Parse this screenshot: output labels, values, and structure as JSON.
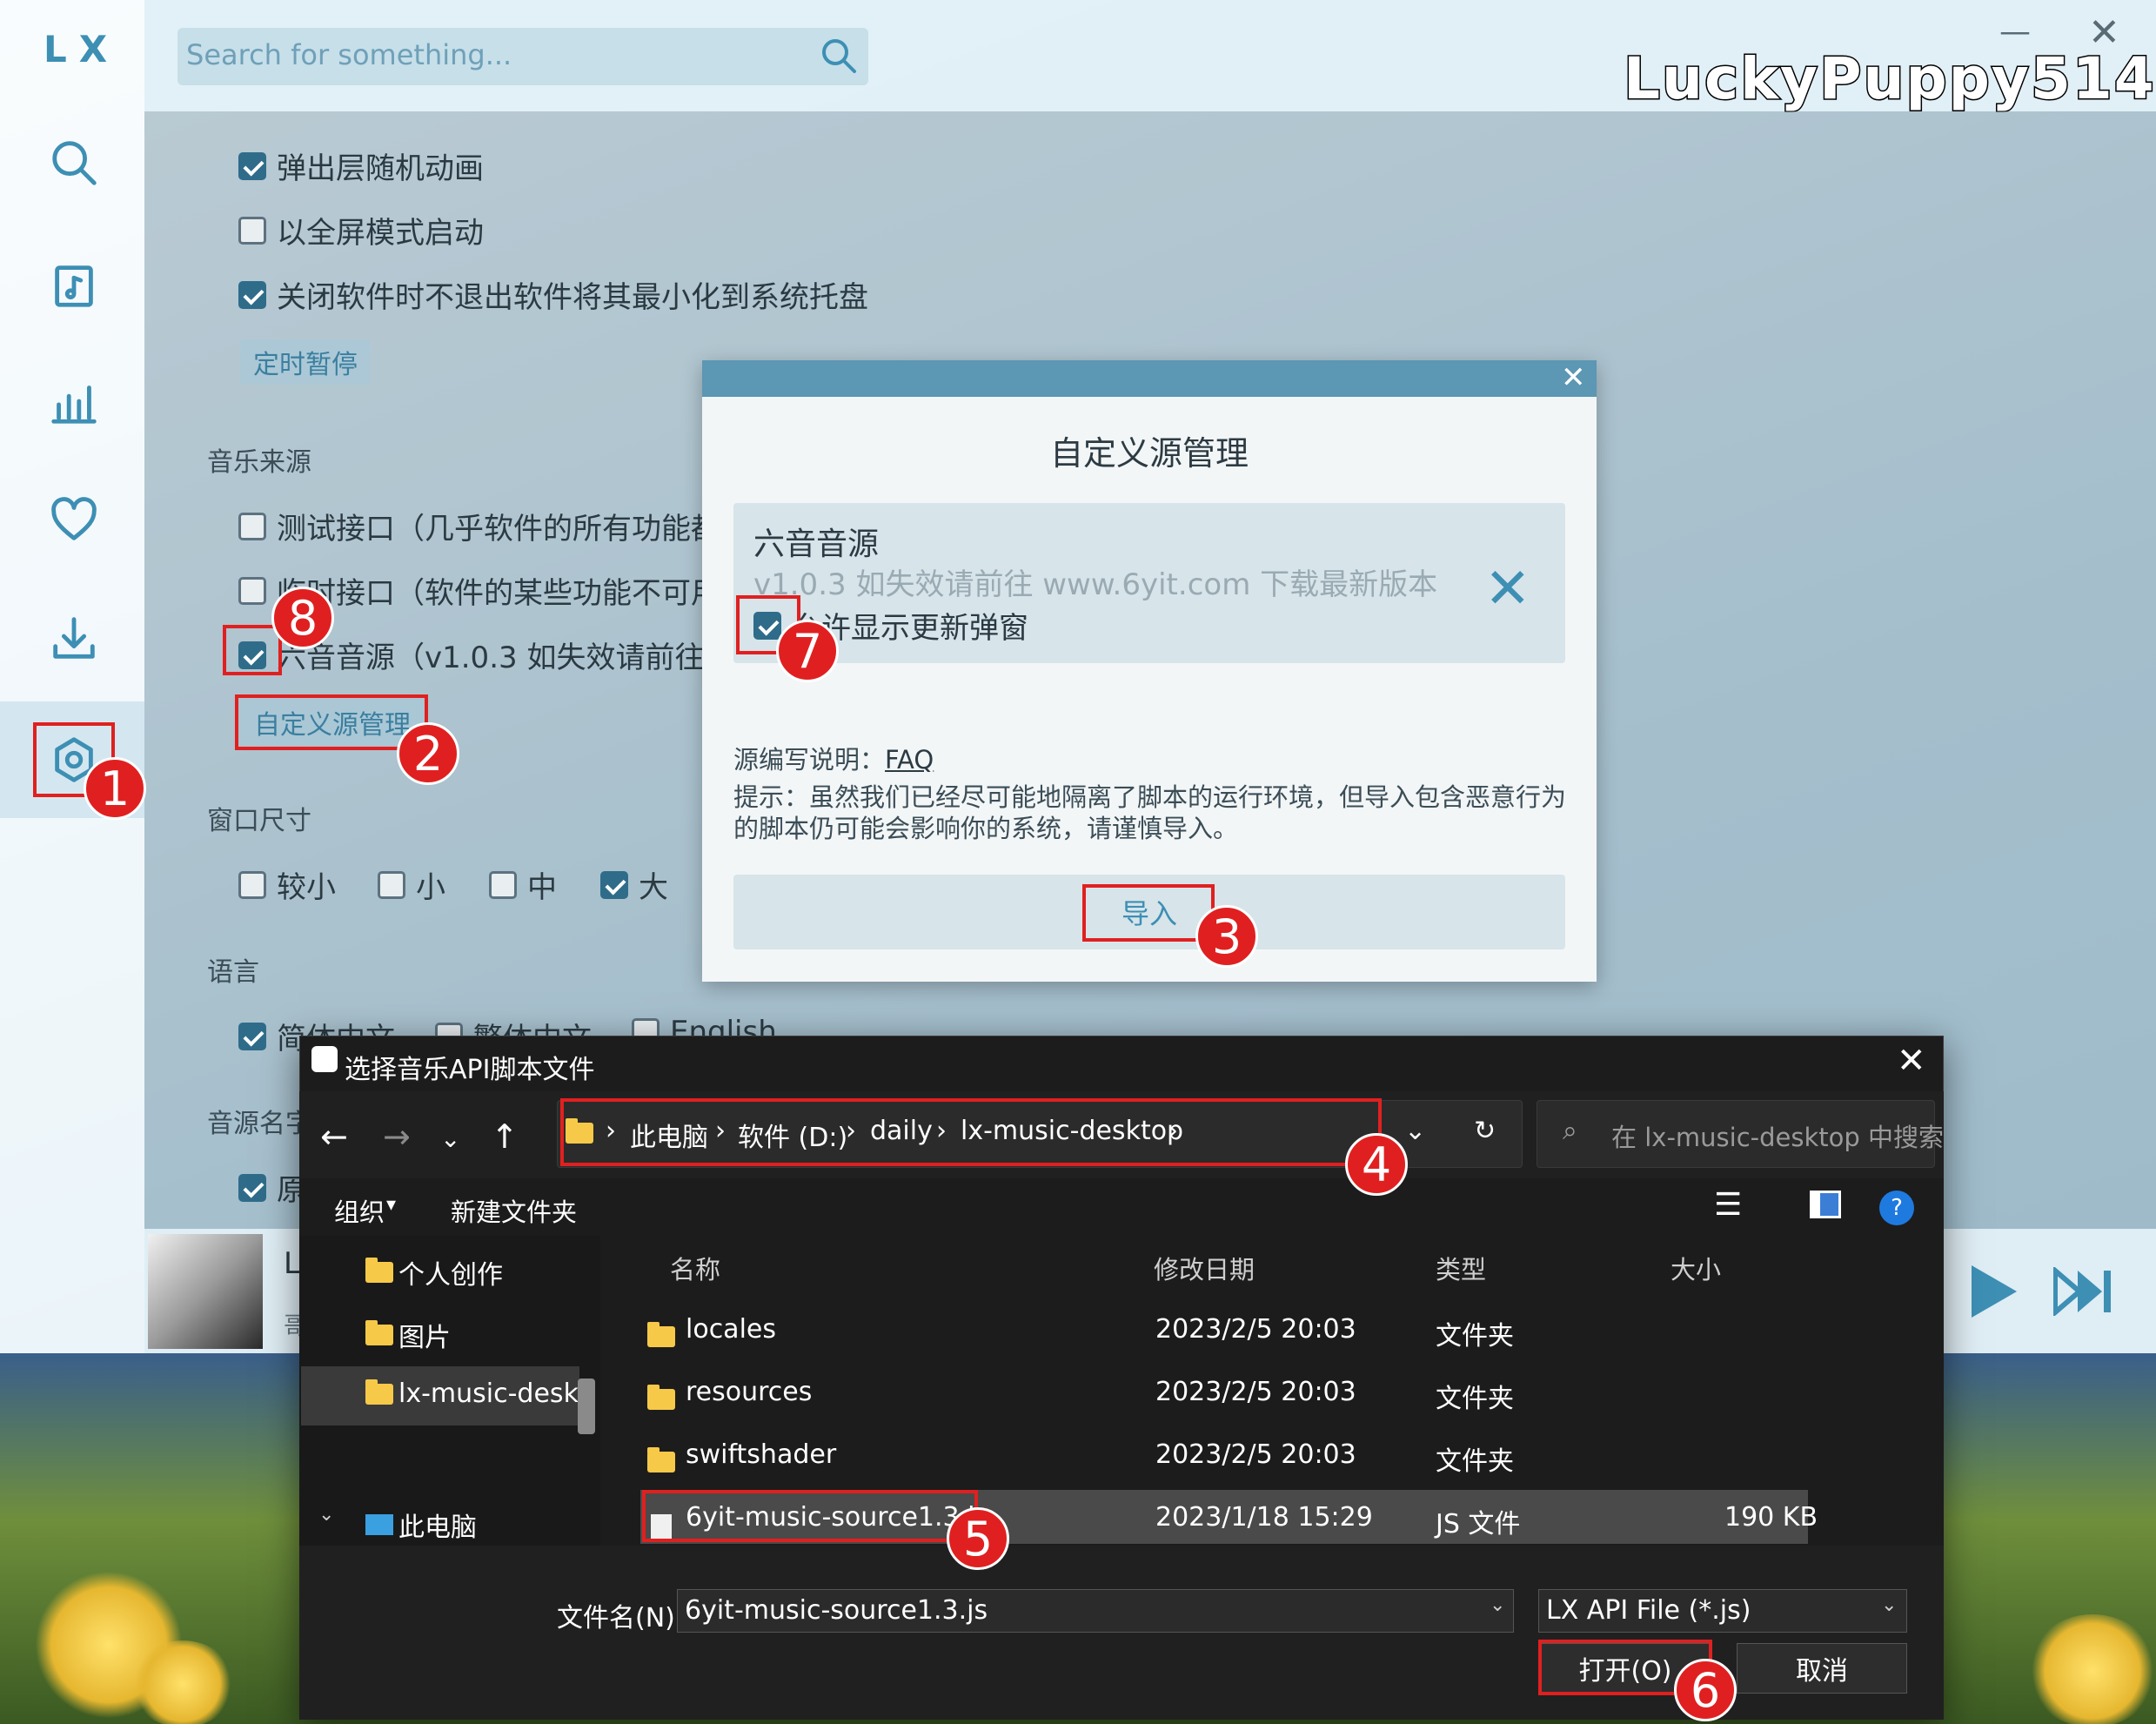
{
  "app": {
    "logo": "LX",
    "brand": "LuckyPuppy514",
    "search_placeholder": "Search for something...",
    "sidebar_icons": [
      "search-icon",
      "music-list-icon",
      "chart-icon",
      "heart-icon",
      "download-icon",
      "settings-icon"
    ]
  },
  "settings": {
    "opt_popup_anim": "弹出层随机动画",
    "opt_fullscreen": "以全屏模式启动",
    "opt_minimize_tray": "关闭软件时不退出软件将其最小化到系统托盘",
    "btn_timer": "定时暂停",
    "sec_music_source": "音乐来源",
    "src_test": "测试接口（几乎软件的所有功能都",
    "src_temp": "临时接口（软件的某些功能不可用",
    "src_six": "六音音源（v1.0.3 如失效请前往 w",
    "btn_custom_source": "自定义源管理",
    "sec_window_size": "窗口尺寸",
    "size_options": [
      "较小",
      "小",
      "中",
      "大"
    ],
    "sec_language": "语言",
    "lang_options": [
      "简体中文",
      "繁体中文",
      "English"
    ],
    "sec_source_name": "音源名字",
    "source_name_option": "原"
  },
  "player": {
    "title_initial": "L",
    "artist_initial": "哥"
  },
  "source_dialog": {
    "title": "自定义源管理",
    "source_name": "六音音源",
    "source_desc": "v1.0.3 如失效请前往 www.6yit.com 下载最新版本",
    "allow_update_popup": "允许显示更新弹窗",
    "faq_label": "源编写说明：",
    "faq_link": "FAQ",
    "tip": "提示：虽然我们已经尽可能地隔离了脚本的运行环境，但导入包含恶意行为的脚本仍可能会影响你的系统，请谨慎导入。",
    "import_label": "导入"
  },
  "file_dialog": {
    "title": "选择音乐API脚本文件",
    "breadcrumb": [
      "此电脑",
      "软件 (D:)",
      "daily",
      "lx-music-desktop"
    ],
    "search_placeholder": "在 lx-music-desktop 中搜索",
    "toolbar_organize": "组织",
    "toolbar_new_folder": "新建文件夹",
    "nav_items": [
      "个人创作",
      "图片",
      "lx-music-deskt",
      "此电脑"
    ],
    "columns": [
      "名称",
      "修改日期",
      "类型",
      "大小"
    ],
    "files": [
      {
        "name": "locales",
        "date": "2023/2/5 20:03",
        "type": "文件夹",
        "size": ""
      },
      {
        "name": "resources",
        "date": "2023/2/5 20:03",
        "type": "文件夹",
        "size": ""
      },
      {
        "name": "swiftshader",
        "date": "2023/2/5 20:03",
        "type": "文件夹",
        "size": ""
      },
      {
        "name": "6yit-music-source1.3.js",
        "date": "2023/1/18 15:29",
        "type": "JS 文件",
        "size": "190 KB"
      }
    ],
    "filename_label": "文件名(N):",
    "filename_value": "6yit-music-source1.3.js",
    "filetype_value": "LX API File (*.js)",
    "open_label": "打开(O)",
    "cancel_label": "取消"
  },
  "annotations": [
    "1",
    "2",
    "3",
    "4",
    "5",
    "6",
    "7",
    "8"
  ],
  "colors": {
    "accent": "#3d8fb4",
    "annotation": "#e02020",
    "dialog_header": "#5c97b3"
  }
}
